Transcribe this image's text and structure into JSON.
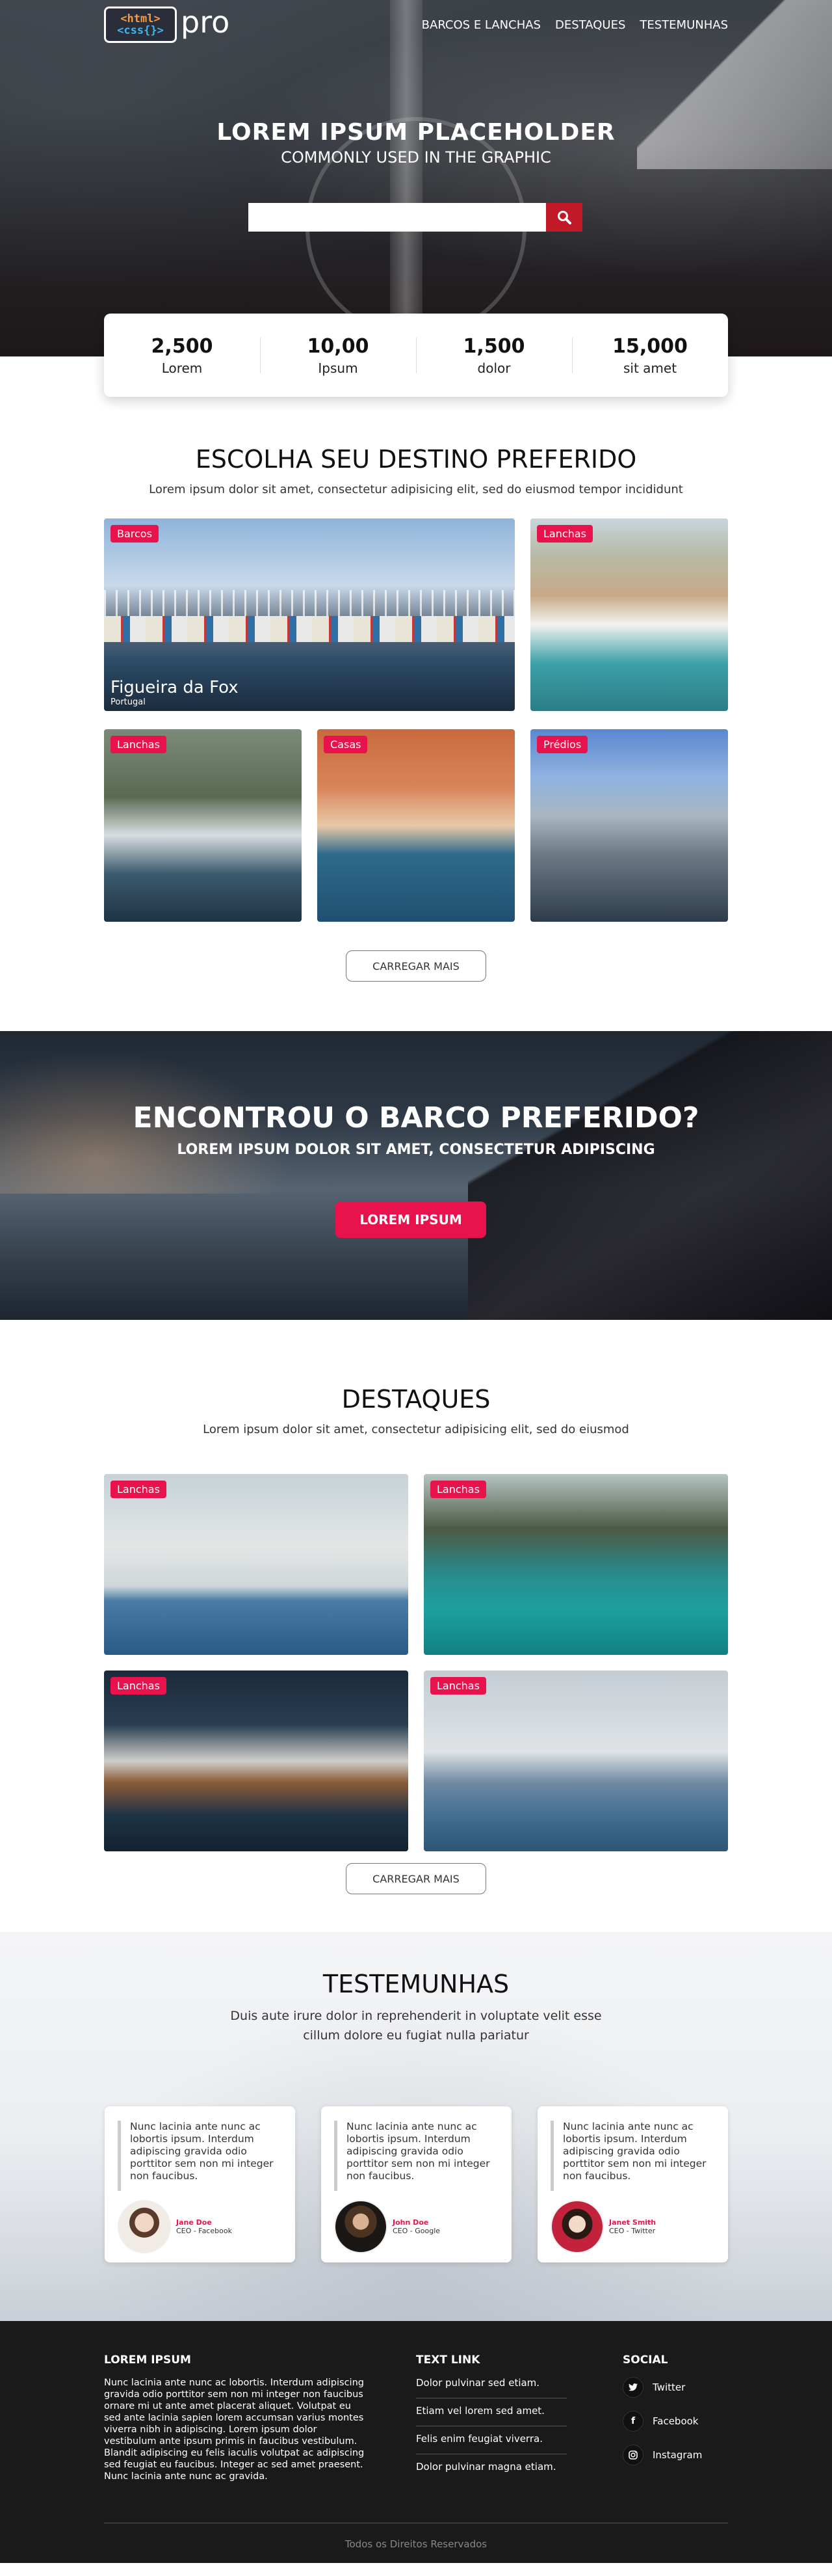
{
  "header": {
    "logo_line1": "<html>",
    "logo_line2": "<css{}>",
    "logo_pro": "pro",
    "menu": [
      "BARCOS E LANCHAS",
      "DESTAQUES",
      "TESTEMUNHAS"
    ]
  },
  "hero": {
    "title": "LOREM IPSUM PLACEHOLDER",
    "subtitle": "COMMONLY USED IN THE GRAPHIC",
    "search_placeholder": ""
  },
  "stats": [
    {
      "value": "2,500",
      "label": "Lorem"
    },
    {
      "value": "10,00",
      "label": "Ipsum"
    },
    {
      "value": "1,500",
      "label": "dolor"
    },
    {
      "value": "15,000",
      "label": "sit amet"
    }
  ],
  "destinos": {
    "title": "ESCOLHA SEU DESTINO PREFERIDO",
    "subtitle": "Lorem ipsum dolor sit amet, consectetur adipisicing elit, sed do eiusmod tempor incididunt",
    "cards": [
      {
        "tag": "Barcos",
        "caption": "Figueira da Fox",
        "sub": "Portugal"
      },
      {
        "tag": "Lanchas"
      },
      {
        "tag": "Lanchas"
      },
      {
        "tag": "Casas"
      },
      {
        "tag": "Prédios"
      }
    ],
    "load_more": "CARREGAR MAIS"
  },
  "banner": {
    "title": "ENCONTROU O BARCO PREFERIDO?",
    "subtitle": "LOREM IPSUM DOLOR SIT AMET, CONSECTETUR ADIPISCING",
    "cta": "LOREM IPSUM"
  },
  "destaques": {
    "title": "DESTAQUES",
    "subtitle": "Lorem ipsum dolor sit amet, consectetur adipisicing elit, sed do eiusmod",
    "cards": [
      {
        "tag": "Lanchas"
      },
      {
        "tag": "Lanchas"
      },
      {
        "tag": "Lanchas"
      },
      {
        "tag": "Lanchas"
      }
    ],
    "load_more": "CARREGAR MAIS"
  },
  "testemunhas": {
    "title": "TESTEMUNHAS",
    "subtitle_l1": "Duis aute irure dolor in reprehenderit in voluptate velit esse",
    "subtitle_l2": "cillum dolore eu fugiat nulla pariatur",
    "items": [
      {
        "quote": "Nunc lacinia ante nunc ac lobortis ipsum. Interdum adipiscing gravida odio porttitor sem non mi integer non faucibus.",
        "name": "Jane Doe",
        "role": "CEO - Facebook"
      },
      {
        "quote": "Nunc lacinia ante nunc ac lobortis ipsum. Interdum adipiscing gravida odio porttitor sem non mi integer non faucibus.",
        "name": "John Doe",
        "role": "CEO - Google"
      },
      {
        "quote": "Nunc lacinia ante nunc ac lobortis ipsum. Interdum adipiscing gravida odio porttitor sem non mi integer non faucibus.",
        "name": "Janet Smith",
        "role": "CEO - Twitter"
      }
    ]
  },
  "footer": {
    "col1_title": "LOREM IPSUM",
    "col1_text": "Nunc lacinia ante nunc ac lobortis. Interdum adipiscing gravida odio porttitor sem non mi integer non faucibus ornare mi ut ante amet placerat aliquet. Volutpat eu sed ante lacinia sapien lorem accumsan varius montes viverra nibh in adipiscing. Lorem ipsum dolor vestibulum ante ipsum primis in faucibus vestibulum. Blandit adipiscing eu felis iaculis volutpat ac adipiscing sed feugiat eu faucibus. Integer ac sed amet praesent. Nunc lacinia ante nunc ac gravida.",
    "col2_title": "TEXT LINK",
    "links": [
      "Dolor pulvinar sed etiam.",
      "Etiam vel lorem sed amet.",
      "Felis enim feugiat viverra.",
      "Dolor pulvinar magna etiam."
    ],
    "col3_title": "SOCIAL",
    "social": [
      {
        "label": "Twitter",
        "icon": "twitter-icon"
      },
      {
        "label": "Facebook",
        "icon": "facebook-icon"
      },
      {
        "label": "Instagram",
        "icon": "instagram-icon"
      }
    ],
    "copyright": "Todos os Direitos Reservados"
  },
  "colors": {
    "accent": "#e8134d",
    "search_button": "#c11a29",
    "footer_bg": "#1a1a1a"
  }
}
